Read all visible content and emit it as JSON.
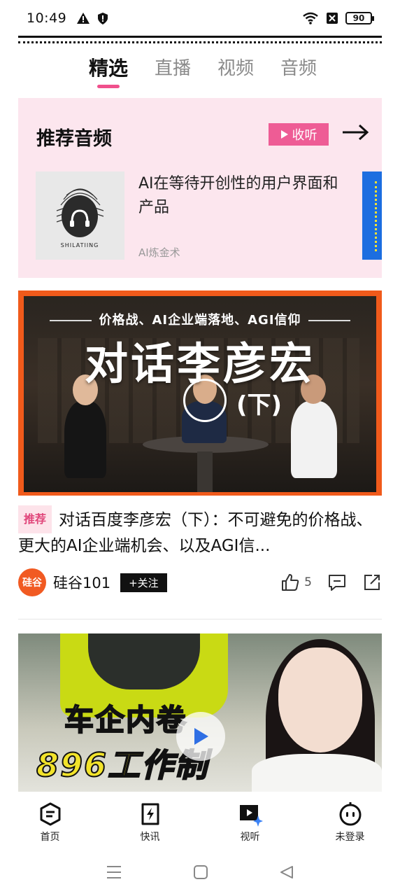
{
  "status_bar": {
    "time": "10:49",
    "battery": "90"
  },
  "tabs": [
    {
      "label": "精选",
      "active": true
    },
    {
      "label": "直播",
      "active": false
    },
    {
      "label": "视频",
      "active": false
    },
    {
      "label": "音频",
      "active": false
    }
  ],
  "audio_section": {
    "title": "推荐音频",
    "listen_label": "收听",
    "item": {
      "title": "AI在等待开创性的用户界面和产品",
      "source": "AI炼金术",
      "cover_text": "SHILATIING"
    }
  },
  "video1": {
    "subtitle": "价格战、AI企业端落地、AGI信仰",
    "headline": "对话李彦宏",
    "part": "(下)",
    "tag": "推荐",
    "title": "对话百度李彦宏（下）：不可避免的价格战、更大的AI企业端机会、以及AGI信...",
    "author": {
      "name": "硅谷101",
      "avatar_text": "硅谷",
      "follow_label": "+关注"
    },
    "likes": "5"
  },
  "video2": {
    "line1": "车企内卷",
    "line2": "896工作制"
  },
  "bottom_nav": [
    {
      "label": "首页",
      "icon": "home-icon"
    },
    {
      "label": "快讯",
      "icon": "flash-news-icon"
    },
    {
      "label": "视听",
      "icon": "media-icon"
    },
    {
      "label": "未登录",
      "icon": "robot-user-icon"
    }
  ],
  "colors": {
    "accent": "#ee5c95",
    "tab_underline": "#f0508c",
    "audio_bg": "#fce6ee",
    "video_border": "#f05a1b"
  }
}
